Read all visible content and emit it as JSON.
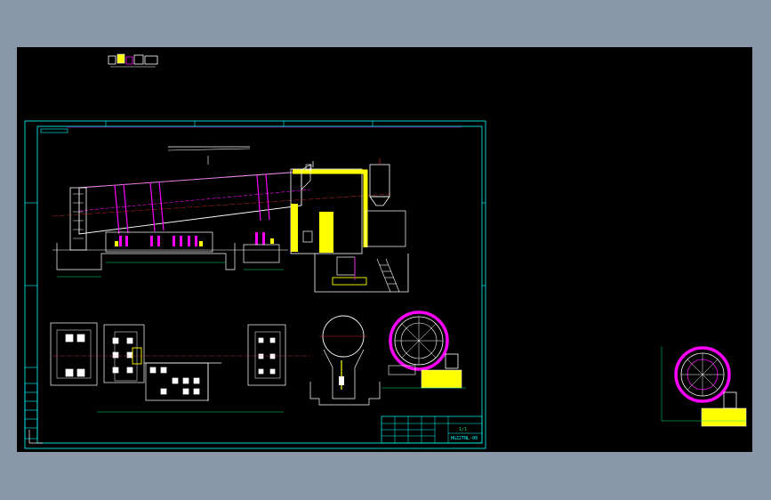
{
  "drawing": {
    "title_block": {
      "sheet_no": "1/1",
      "drawing_code": "HGZ2TNL-00"
    }
  },
  "colors": {
    "background": "#000000",
    "workspace_frame": "#8a97a9",
    "frame_lines": "#00ffff",
    "geometry_white": "#ffffff",
    "geometry_magenta": "#ff00ff",
    "accent_yellow": "#ffff00",
    "dimension_green": "#00e676",
    "centerline_red": "#ff3030"
  },
  "icons": [
    "drawing-legend-icon",
    "ucs-icon"
  ]
}
